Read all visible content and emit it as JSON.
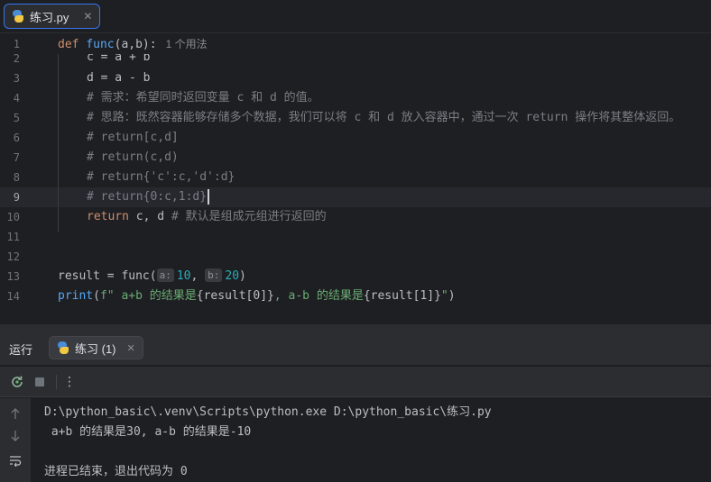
{
  "editor_tab": {
    "filename": "练习.py",
    "close": "✕"
  },
  "gutter": {
    "line_numbers": [
      "1",
      "2",
      "3",
      "4",
      "5",
      "6",
      "7",
      "8",
      "9",
      "10",
      "11",
      "12",
      "13",
      "14"
    ],
    "active_line": "9"
  },
  "code": {
    "line1": {
      "kw": "def",
      "name": "func",
      "params": "(a,b):",
      "usage_hint": "1 个用法"
    },
    "line2": "c = a + b",
    "line3": "d = a - b",
    "line4": "# 需求：希望同时返回变量 c 和 d 的值。",
    "line5": "# 思路：既然容器能够存储多个数据，我们可以将 c 和 d 放入容器中，通过一次 return 操作将其整体返回。",
    "line6": "# return[c,d]",
    "line7": "# return(c,d)",
    "line8": "# return{'c':c,'d':d}",
    "line9": "# return{0:c,1:d}",
    "line10": {
      "kw": "return",
      "rest": " c, d ",
      "comment": "# 默认是组成元组进行返回的"
    },
    "line13": {
      "lhs": "result = func(",
      "hint_a": "a:",
      "val_a": "10",
      "comma": ",",
      "hint_b": "b:",
      "val_b": "20",
      "close": ")"
    },
    "line14": {
      "fn": "print",
      "open": "(",
      "str_start": "f\" a+b 的结果是",
      "expr1": "{result[0]}",
      "str_mid": ", a-b 的结果是",
      "expr2": "{result[1]}",
      "str_end": "\"",
      "close": ")"
    }
  },
  "run_panel": {
    "title": "运行",
    "tab_label": "练习 (1)",
    "tab_close": "✕",
    "toolbar": {
      "rerun_icon": "rerun-icon",
      "stop_icon": "stop-icon",
      "more": "⋮"
    }
  },
  "console": {
    "command": "D:\\python_basic\\.venv\\Scripts\\python.exe D:\\python_basic\\练习.py",
    "output": " a+b 的结果是30, a-b 的结果是-10",
    "exit": "进程已结束，退出代码为 0"
  },
  "colors": {
    "background": "#1e1f22",
    "panel": "#2b2d30",
    "keyword": "#cf8e6d",
    "function": "#56a8f5",
    "number": "#2aacb8",
    "string": "#6aab73",
    "comment": "#7a7e85",
    "accent": "#3574f0"
  }
}
